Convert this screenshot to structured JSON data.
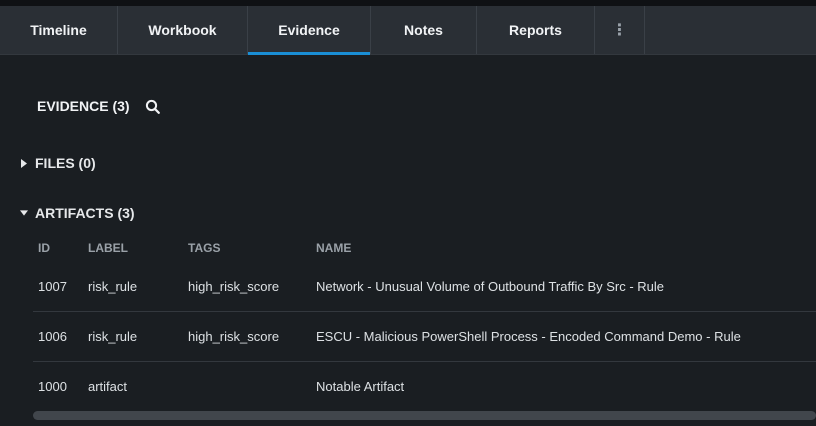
{
  "tabs": [
    {
      "label": "Timeline",
      "active": false
    },
    {
      "label": "Workbook",
      "active": false
    },
    {
      "label": "Evidence",
      "active": true
    },
    {
      "label": "Notes",
      "active": false
    },
    {
      "label": "Reports",
      "active": false
    }
  ],
  "more_icon": "⋮",
  "accent_color": "#1a8fd6",
  "evidence": {
    "title": "EVIDENCE (3)",
    "search_icon": "search-icon"
  },
  "groups": {
    "files": {
      "label": "FILES (0)",
      "expanded": false
    },
    "artifacts": {
      "label": "ARTIFACTS (3)",
      "expanded": true
    }
  },
  "table": {
    "columns": [
      "ID",
      "LABEL",
      "TAGS",
      "NAME"
    ],
    "rows": [
      {
        "id": "1007",
        "label": "risk_rule",
        "tags": "high_risk_score",
        "name": "Network - Unusual Volume of Outbound Traffic By Src - Rule"
      },
      {
        "id": "1006",
        "label": "risk_rule",
        "tags": "high_risk_score",
        "name": "ESCU - Malicious PowerShell Process - Encoded Command Demo - Rule"
      },
      {
        "id": "1000",
        "label": "artifact",
        "tags": "",
        "name": "Notable Artifact"
      }
    ]
  }
}
